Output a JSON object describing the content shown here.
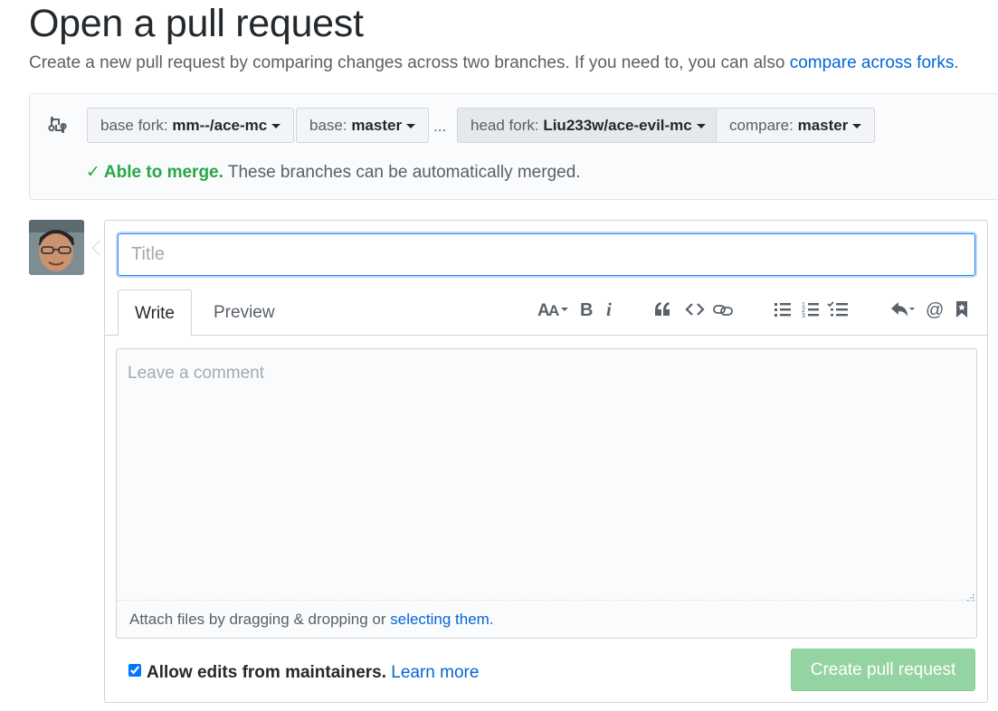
{
  "header": {
    "title": "Open a pull request",
    "subtitle_text": "Create a new pull request by comparing changes across two branches. If you need to, you can also ",
    "subtitle_link": "compare across forks",
    "subtitle_end": "."
  },
  "compare": {
    "base_fork": {
      "prefix": "base fork: ",
      "value": "mm--/ace-mc"
    },
    "base": {
      "prefix": "base: ",
      "value": "master"
    },
    "separator": "...",
    "head_fork": {
      "prefix": "head fork: ",
      "value": "Liu233w/ace-evil-mc"
    },
    "compare_branch": {
      "prefix": "compare: ",
      "value": "master"
    },
    "merge_status": {
      "check": "✓",
      "strong": "Able to merge.",
      "text": " These branches can be automatically merged."
    }
  },
  "form": {
    "title_placeholder": "Title",
    "tabs": [
      {
        "label": "Write"
      },
      {
        "label": "Preview"
      }
    ],
    "toolbar_icons": [
      "text-size-icon",
      "bold-icon",
      "italic-icon",
      "quote-icon",
      "code-icon",
      "link-icon",
      "bulleted-list-icon",
      "numbered-list-icon",
      "task-list-icon",
      "reply-icon",
      "mention-icon",
      "bookmark-icon"
    ],
    "comment_placeholder": "Leave a comment",
    "attach_text": "Attach files by dragging & dropping or ",
    "attach_link": "selecting them",
    "attach_end": ".",
    "allow_edits_label": "Allow edits from maintainers.",
    "learn_more": "Learn more",
    "allow_edits_checked": true,
    "submit_label": "Create pull request"
  },
  "colors": {
    "accent": "#0366d6",
    "success": "#28a745",
    "submit_disabled": "#94d3a2"
  }
}
